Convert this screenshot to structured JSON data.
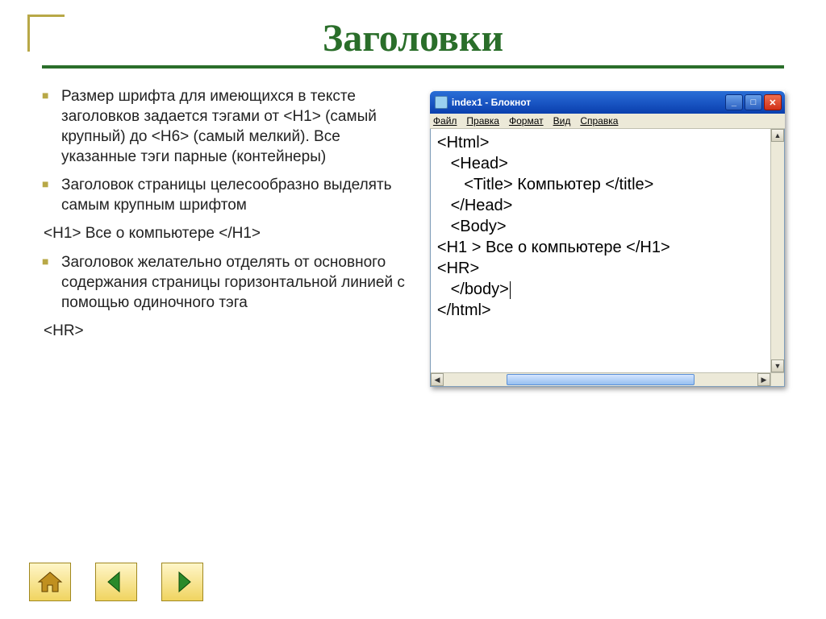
{
  "slide": {
    "title": "Заголовки",
    "bullets": {
      "b1": "Размер шрифта для имеющихся в тексте заголовков задается тэгами от <H1> (самый крупный) до <H6> (самый мелкий). Все указанные тэги парные (контейнеры)",
      "b2": "Заголовок страницы целесообразно выделять самым крупным шрифтом",
      "code1": "<H1> Все о компьютере </H1>",
      "b3": "Заголовок желательно отделять от основного содержания страницы горизонтальной линией с помощью одиночного тэга",
      "code2": "<HR>"
    }
  },
  "notepad": {
    "title": "index1 - Блокнот",
    "menu": {
      "file": "Файл",
      "edit": "Правка",
      "format": "Формат",
      "view": "Вид",
      "help": "Справка"
    },
    "lines": {
      "l1": "<Html>",
      "l2": "   <Head>",
      "l3": "      <Title> Компьютер </title>",
      "l4": "   </Head>",
      "l5": "   <Body>",
      "l6": "<H1 > Все о компьютере </H1>",
      "l7": "<HR>",
      "l8": "   </body>",
      "l9": "</html>"
    }
  },
  "nav": {
    "home": "home",
    "prev": "prev",
    "next": "next"
  }
}
